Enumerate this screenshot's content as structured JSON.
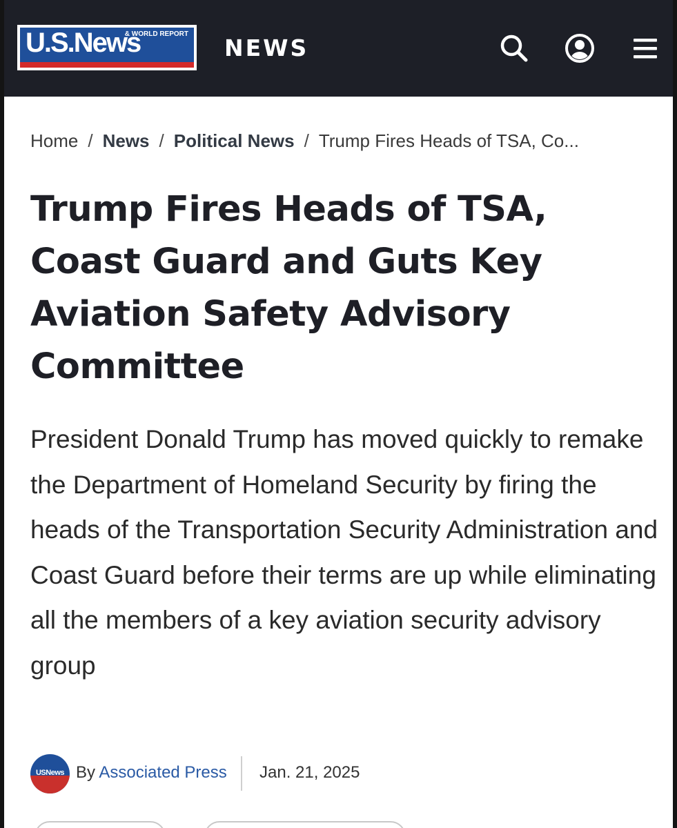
{
  "header": {
    "logo": {
      "wordmark": "U.S.News",
      "subline": "& WORLD REPORT"
    },
    "section_label": "NEWS",
    "icons": [
      "search-icon",
      "account-icon",
      "menu-icon"
    ]
  },
  "breadcrumb": {
    "items": [
      "Home",
      "News",
      "Political News",
      "Trump Fires Heads of TSA, Co..."
    ],
    "separator": "/"
  },
  "article": {
    "headline": "Trump Fires Heads of TSA, Coast Guard and Guts Key Aviation Safety Advisory Committee",
    "dek": "President Donald Trump has moved quickly to remake the Department of Homeland Security by firing the heads of the Transportation Security Administration and Coast Guard before their terms are up while eliminating all the members of a key aviation security advisory group",
    "byline": {
      "avatar_text": "USNews",
      "by_prefix": "By",
      "author": "Associated Press",
      "date": "Jan. 21, 2025"
    }
  },
  "colors": {
    "header_bg": "#1d1f27",
    "logo_blue": "#1f4f9a",
    "logo_red": "#d42a2a",
    "headline_text": "#1e1f26",
    "author_link": "#2a5aa5"
  }
}
